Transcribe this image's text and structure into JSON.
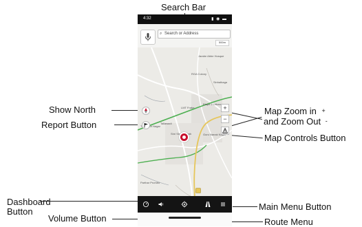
{
  "callouts": {
    "search_bar": "Search Bar",
    "show_north": "Show North",
    "report_button": "Report Button",
    "map_zoom_line1": "Map Zoom in",
    "map_zoom_plus": "+",
    "map_zoom_line2": "and Zoom Out",
    "map_zoom_minus": "-",
    "map_controls_button": "Map Controls Button",
    "dashboard_line1": "Dashboard",
    "dashboard_line2": "Button",
    "volume_button": "Volume Button",
    "main_menu_button": "Main Menu Button",
    "route_menu": "Route Menu"
  },
  "phone": {
    "status_time": "4:32",
    "search_placeholder": "Search or Address",
    "scale_text": "500m",
    "zoom_in_symbol": "+",
    "zoom_out_symbol": "−",
    "map_labels": {
      "l1": "Jarabe Abbe Hosque",
      "l2": "RGA Colony",
      "l3": "Sinhalbaga",
      "l4": "Etape 2 Urban",
      "l5": "LMT Frabe",
      "l6": "Transport Nagar",
      "l7": "Tallawadi",
      "l8": "Shri Shyam Nath",
      "l9": "Guru Nanak Nagar",
      "l10": "Parthar Prombo"
    }
  },
  "colors": {
    "bottom_bar": "#141414",
    "status_bar": "#101010",
    "pin": "#c8102e",
    "road_green": "#4caf50",
    "road_yellow": "#e6c65a"
  }
}
